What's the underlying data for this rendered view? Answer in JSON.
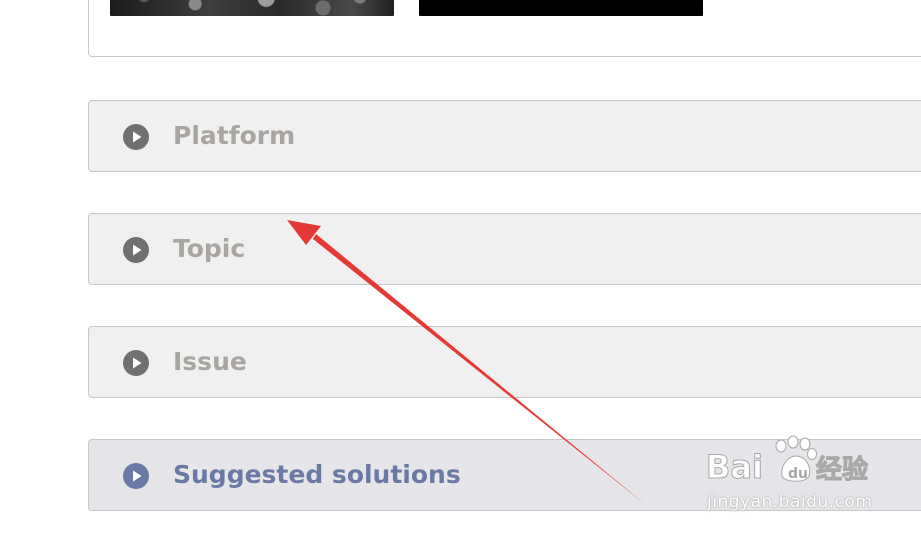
{
  "accordion": {
    "items": [
      {
        "label": "Platform",
        "icon": "play-circle-icon",
        "highlighted": false
      },
      {
        "label": "Topic",
        "icon": "play-circle-icon",
        "highlighted": false
      },
      {
        "label": "Issue",
        "icon": "play-circle-icon",
        "highlighted": false
      },
      {
        "label": "Suggested solutions",
        "icon": "play-circle-icon",
        "highlighted": true
      }
    ]
  },
  "watermark": {
    "logo_text": "Bai经验",
    "url": "jingyan.baidu.com"
  },
  "colors": {
    "row_background": "#f0f0f0",
    "row_border": "#c8c8c8",
    "row_label": "#a9a6a2",
    "highlight_background": "#e6e6ea",
    "highlight_label": "#6a7aa4",
    "annotation_arrow": "#e53935"
  }
}
